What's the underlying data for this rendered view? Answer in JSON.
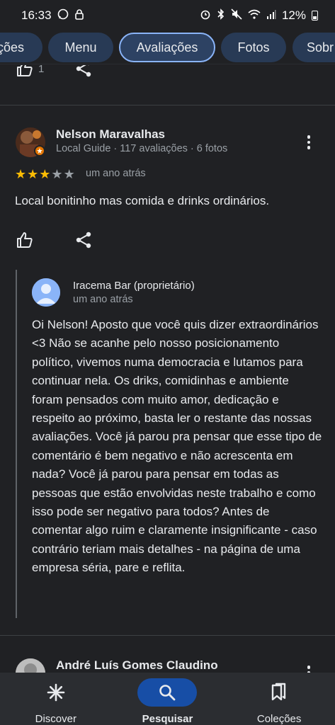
{
  "status_bar": {
    "time": "16:33",
    "battery": "12%",
    "left_icons": [
      "whatsapp-icon",
      "lock-icon"
    ],
    "right_icons": [
      "alarm-icon",
      "bluetooth-icon",
      "mute-icon",
      "wifi-icon",
      "signal-icon",
      "battery-icon"
    ]
  },
  "chips": [
    {
      "label": "ções",
      "active": false
    },
    {
      "label": "Menu",
      "active": false
    },
    {
      "label": "Avaliações",
      "active": true
    },
    {
      "label": "Fotos",
      "active": false
    },
    {
      "label": "Sobr",
      "active": false
    }
  ],
  "previous_review": {
    "like_count": "1"
  },
  "review": {
    "author": "Nelson Maravalhas",
    "badge": "Local Guide",
    "review_count": "117 avaliações",
    "photo_count": "6 fotos",
    "rating": 3,
    "rating_max": 5,
    "date": "um ano atrás",
    "text": "Local bonitinho mas comida e drinks ordinários."
  },
  "owner_reply": {
    "owner": "Iracema Bar (proprietário)",
    "date": "um ano atrás",
    "text": "Oi Nelson! Aposto que você quis dizer extraordinários <3 Não se acanhe pelo nosso posicionamento político, vivemos numa democracia e lutamos para continuar nela. Os driks, comidinhas e ambiente foram pensados com muito amor, dedicação e respeito ao próximo, basta ler o restante das nossas avaliações. Você já parou pra pensar que esse tipo de comentário é bem negativo e não acrescenta em nada? Você já parou para pensar em todas as pessoas que estão envolvidas neste trabalho e como isso pode ser negativo para todos? Antes de comentar algo ruim e claramente insignificante - caso contrário teriam mais detalhes - na página de uma empresa séria, pare e reflita."
  },
  "next_review": {
    "author": "André Luís Gomes Claudino"
  },
  "bottom_nav": [
    {
      "label": "Discover",
      "icon": "discover-icon",
      "active": false
    },
    {
      "label": "Pesquisar",
      "icon": "search-icon",
      "active": true
    },
    {
      "label": "Coleções",
      "icon": "collections-icon",
      "active": false
    }
  ],
  "colors": {
    "accent": "#8ab4f8",
    "star": "#fbbc04",
    "background": "#202124"
  }
}
